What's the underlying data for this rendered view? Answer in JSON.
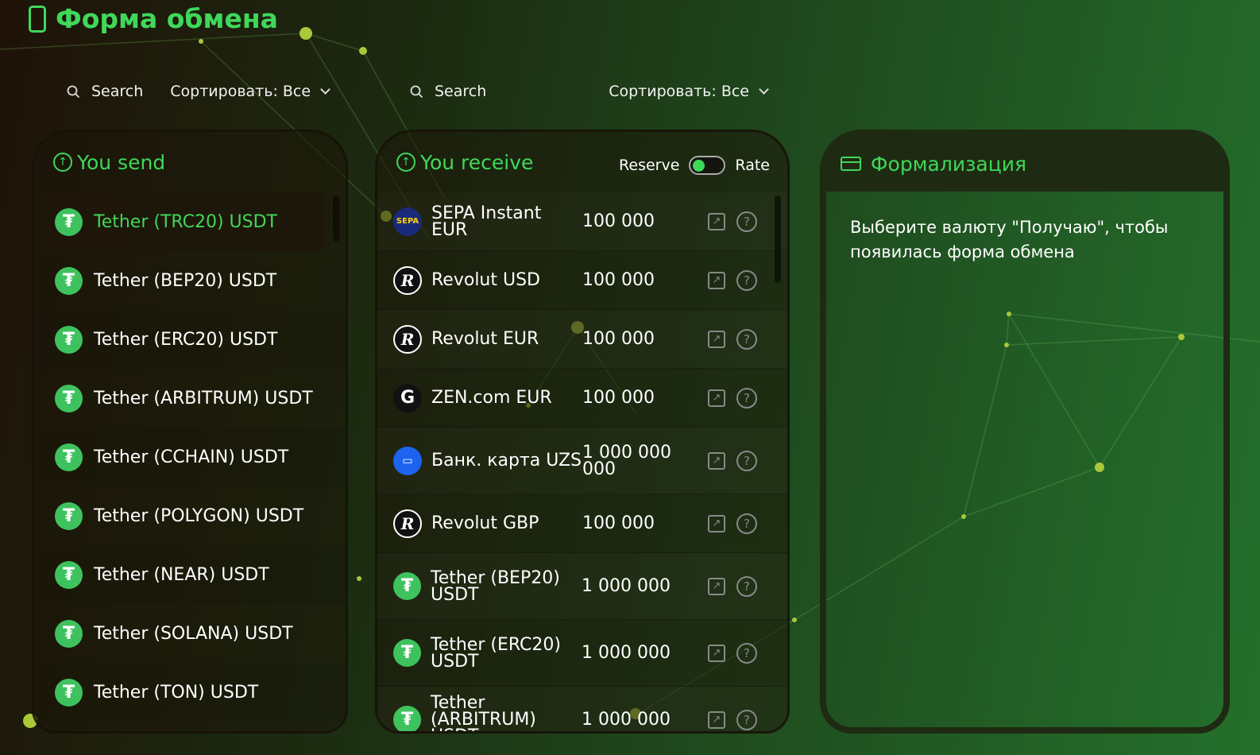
{
  "page": {
    "title": "Форма обмена"
  },
  "colors": {
    "accent": "#3fd85a",
    "tether": "#3ec25e"
  },
  "send_toolbar": {
    "search_label": "Search",
    "sort_label": "Сортировать: Все"
  },
  "recv_toolbar": {
    "search_label": "Search",
    "sort_label": "Сортировать: Все"
  },
  "send": {
    "title": "You send",
    "items": [
      {
        "label": "Tether (TRC20) USDT",
        "selected": true
      },
      {
        "label": "Tether (BEP20) USDT"
      },
      {
        "label": "Tether (ERC20) USDT"
      },
      {
        "label": "Tether (ARBITRUM) USDT"
      },
      {
        "label": "Tether (CCHAIN) USDT"
      },
      {
        "label": "Tether (POLYGON) USDT"
      },
      {
        "label": "Tether (NEAR) USDT"
      },
      {
        "label": "Tether (SOLANA) USDT"
      },
      {
        "label": "Tether (TON) USDT"
      }
    ]
  },
  "receive": {
    "title": "You receive",
    "toggle_left": "Reserve",
    "toggle_right": "Rate",
    "items": [
      {
        "icon": "sepa-icon",
        "glyph": "SEPA",
        "name": "SEPA Instant EUR",
        "amount": "100 000"
      },
      {
        "icon": "revolut-icon",
        "glyph": "R",
        "name": "Revolut USD",
        "amount": "100 000"
      },
      {
        "icon": "revolut-icon",
        "glyph": "R",
        "name": "Revolut EUR",
        "amount": "100 000"
      },
      {
        "icon": "zen-icon",
        "glyph": "G",
        "name": "ZEN.com EUR",
        "amount": "100 000"
      },
      {
        "icon": "bank-card-icon",
        "glyph": "▭",
        "name": "Банк. карта UZS",
        "amount": "1 000 000 000"
      },
      {
        "icon": "revolut-icon",
        "glyph": "R",
        "name": "Revolut GBP",
        "amount": "100 000"
      },
      {
        "icon": "tether-icon",
        "glyph": "₮",
        "name": "Tether (BEP20) USDT",
        "amount": "1 000 000"
      },
      {
        "icon": "tether-icon",
        "glyph": "₮",
        "name": "Tether (ERC20) USDT",
        "amount": "1 000 000"
      },
      {
        "icon": "tether-icon",
        "glyph": "₮",
        "name": "Tether (ARBITRUM) USDT",
        "amount": "1 000 000"
      }
    ]
  },
  "form": {
    "title": "Формализация",
    "message": "Выберите валюту \"Получаю\", чтобы появилась форма обмена"
  }
}
